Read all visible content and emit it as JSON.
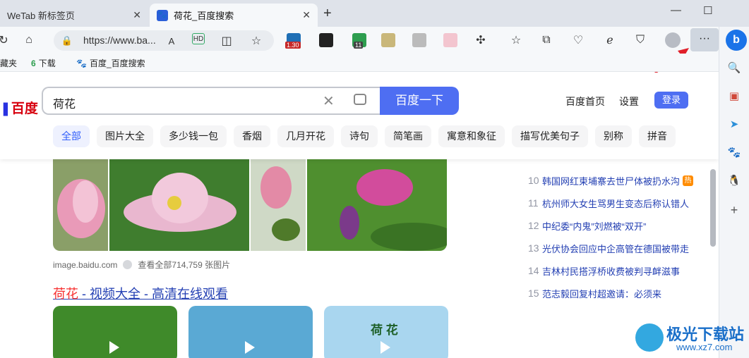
{
  "tabs": [
    {
      "label": "WeTab 新标签页",
      "active": false
    },
    {
      "label": "荷花_百度搜索",
      "active": true
    }
  ],
  "address_bar": {
    "url": "https://www.ba..."
  },
  "extensions": [
    {
      "name": "ext-badge-1",
      "badge": "1.30"
    },
    {
      "name": "ext-badge-2",
      "badge": "11"
    }
  ],
  "more_button": {
    "label": "···"
  },
  "bookmarks": [
    {
      "label": "藏夹"
    },
    {
      "label": "下载",
      "icon_text": "6"
    },
    {
      "label": "百度_百度搜索"
    }
  ],
  "search": {
    "logo": "百度",
    "query": "荷花",
    "button_label": "百度一下"
  },
  "header_links": {
    "home": "百度首页",
    "settings": "设置",
    "login": "登录"
  },
  "filter_tags": [
    "全部",
    "图片大全",
    "多少钱一包",
    "香烟",
    "几月开花",
    "诗句",
    "简笔画",
    "寓意和象征",
    "描写优美句子",
    "别称",
    "拼音"
  ],
  "image_source": {
    "domain": "image.baidu.com",
    "view_all": "查看全部714,759 张图片"
  },
  "video_result": {
    "highlight": "荷花",
    "title_rest": " - 视频大全 - 高清在线观看"
  },
  "video_thumb_caption": "荷 花",
  "hot_list": [
    {
      "rank": "10",
      "title": "韩国网红柬埔寨去世尸体被扔水沟",
      "badge": "热"
    },
    {
      "rank": "11",
      "title": "杭州师大女生骂男生变态后称认错人"
    },
    {
      "rank": "12",
      "title": "中纪委“内鬼”刘燃被“双开”"
    },
    {
      "rank": "13",
      "title": "光伏协会回应中企高管在德国被带走"
    },
    {
      "rank": "14",
      "title": "吉林村民搭浮桥收费被判寻衅滋事"
    },
    {
      "rank": "15",
      "title": "范志毅回复村超邀请：必须来"
    }
  ],
  "watermark": {
    "title": "极光下载站",
    "url": "www.xz7.com"
  },
  "colors": {
    "accent": "#4e6ef2",
    "link": "#2440b3",
    "highlight": "#f73131",
    "arrow": "#e0202a"
  }
}
